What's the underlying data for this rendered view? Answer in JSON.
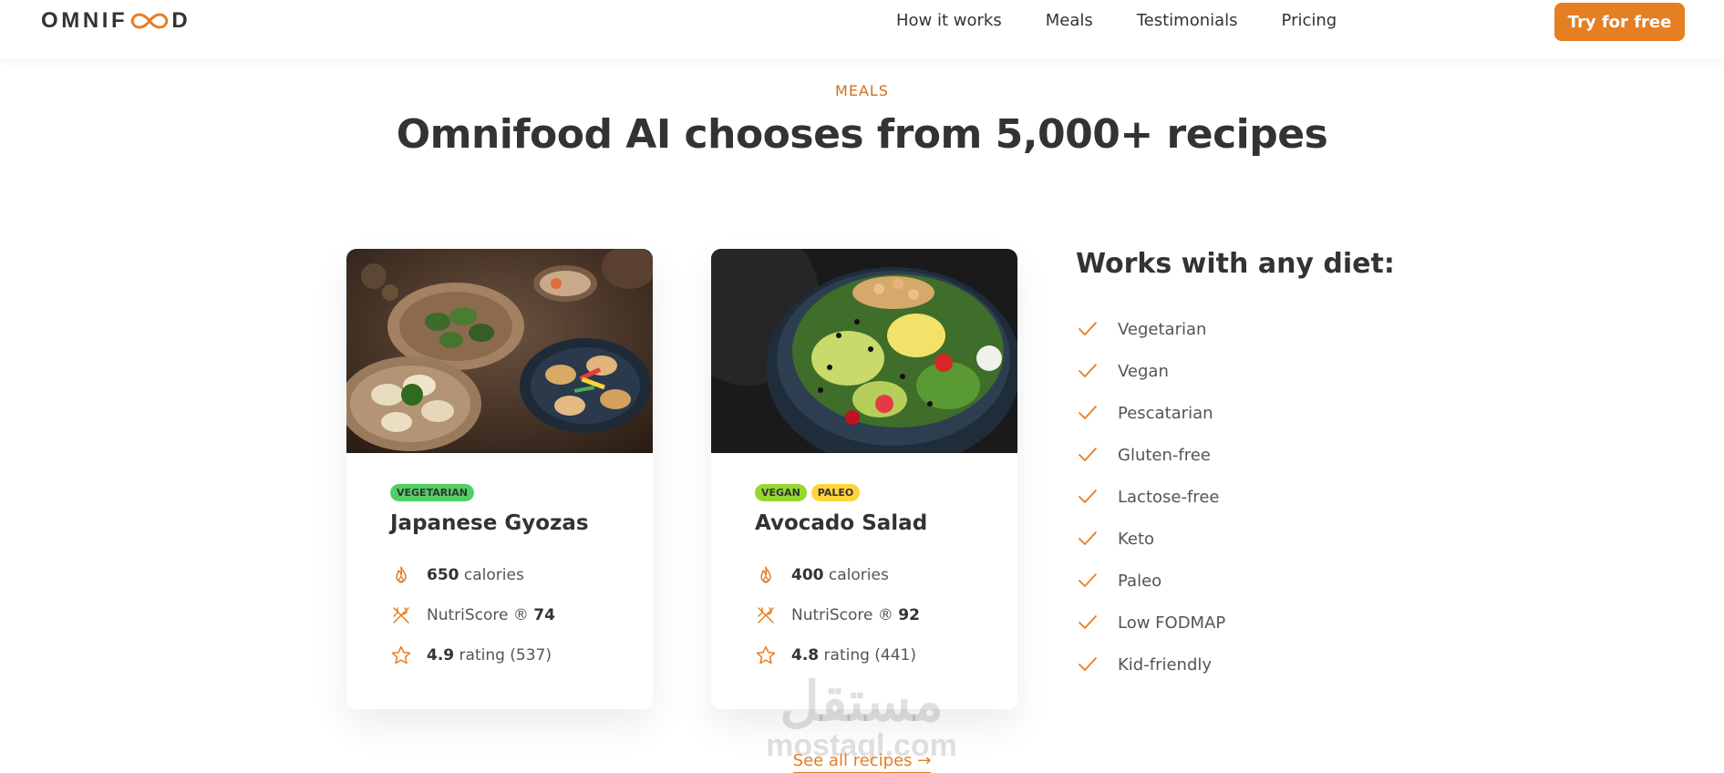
{
  "header": {
    "logo": {
      "prefix": "OMNIF",
      "suffix": "D",
      "icon": "infinity-logo-icon"
    },
    "nav": [
      "How it works",
      "Meals",
      "Testimonials",
      "Pricing"
    ],
    "cta_label": "Try for free"
  },
  "section": {
    "subheading": "MEALS",
    "heading": "Omnifood AI chooses from 5,000+ recipes"
  },
  "meals": [
    {
      "image": "gyozas-photo",
      "tags": [
        "VEGETARIAN"
      ],
      "title": "Japanese Gyozas",
      "calories_value": "650",
      "calories_label": "calories",
      "nutri_label": "NutriScore ®",
      "nutri_value": "74",
      "rating_value": "4.9",
      "rating_label": "rating (537)"
    },
    {
      "image": "avocado-salad-photo",
      "tags": [
        "VEGAN",
        "PALEO"
      ],
      "title": "Avocado Salad",
      "calories_value": "400",
      "calories_label": "calories",
      "nutri_label": "NutriScore ®",
      "nutri_value": "92",
      "rating_value": "4.8",
      "rating_label": "rating (441)"
    }
  ],
  "diets": {
    "title": "Works with any diet:",
    "items": [
      "Vegetarian",
      "Vegan",
      "Pescatarian",
      "Gluten-free",
      "Lactose-free",
      "Keto",
      "Paleo",
      "Low FODMAP",
      "Kid-friendly"
    ]
  },
  "see_all": "See all recipes →",
  "watermark": {
    "arabic": "مستقل",
    "latin": "mostaql.com"
  },
  "colors": {
    "accent": "#e67e22",
    "text": "#333333",
    "vegetarian": "#51cf66",
    "vegan": "#94d82d",
    "paleo": "#ffd43b"
  }
}
